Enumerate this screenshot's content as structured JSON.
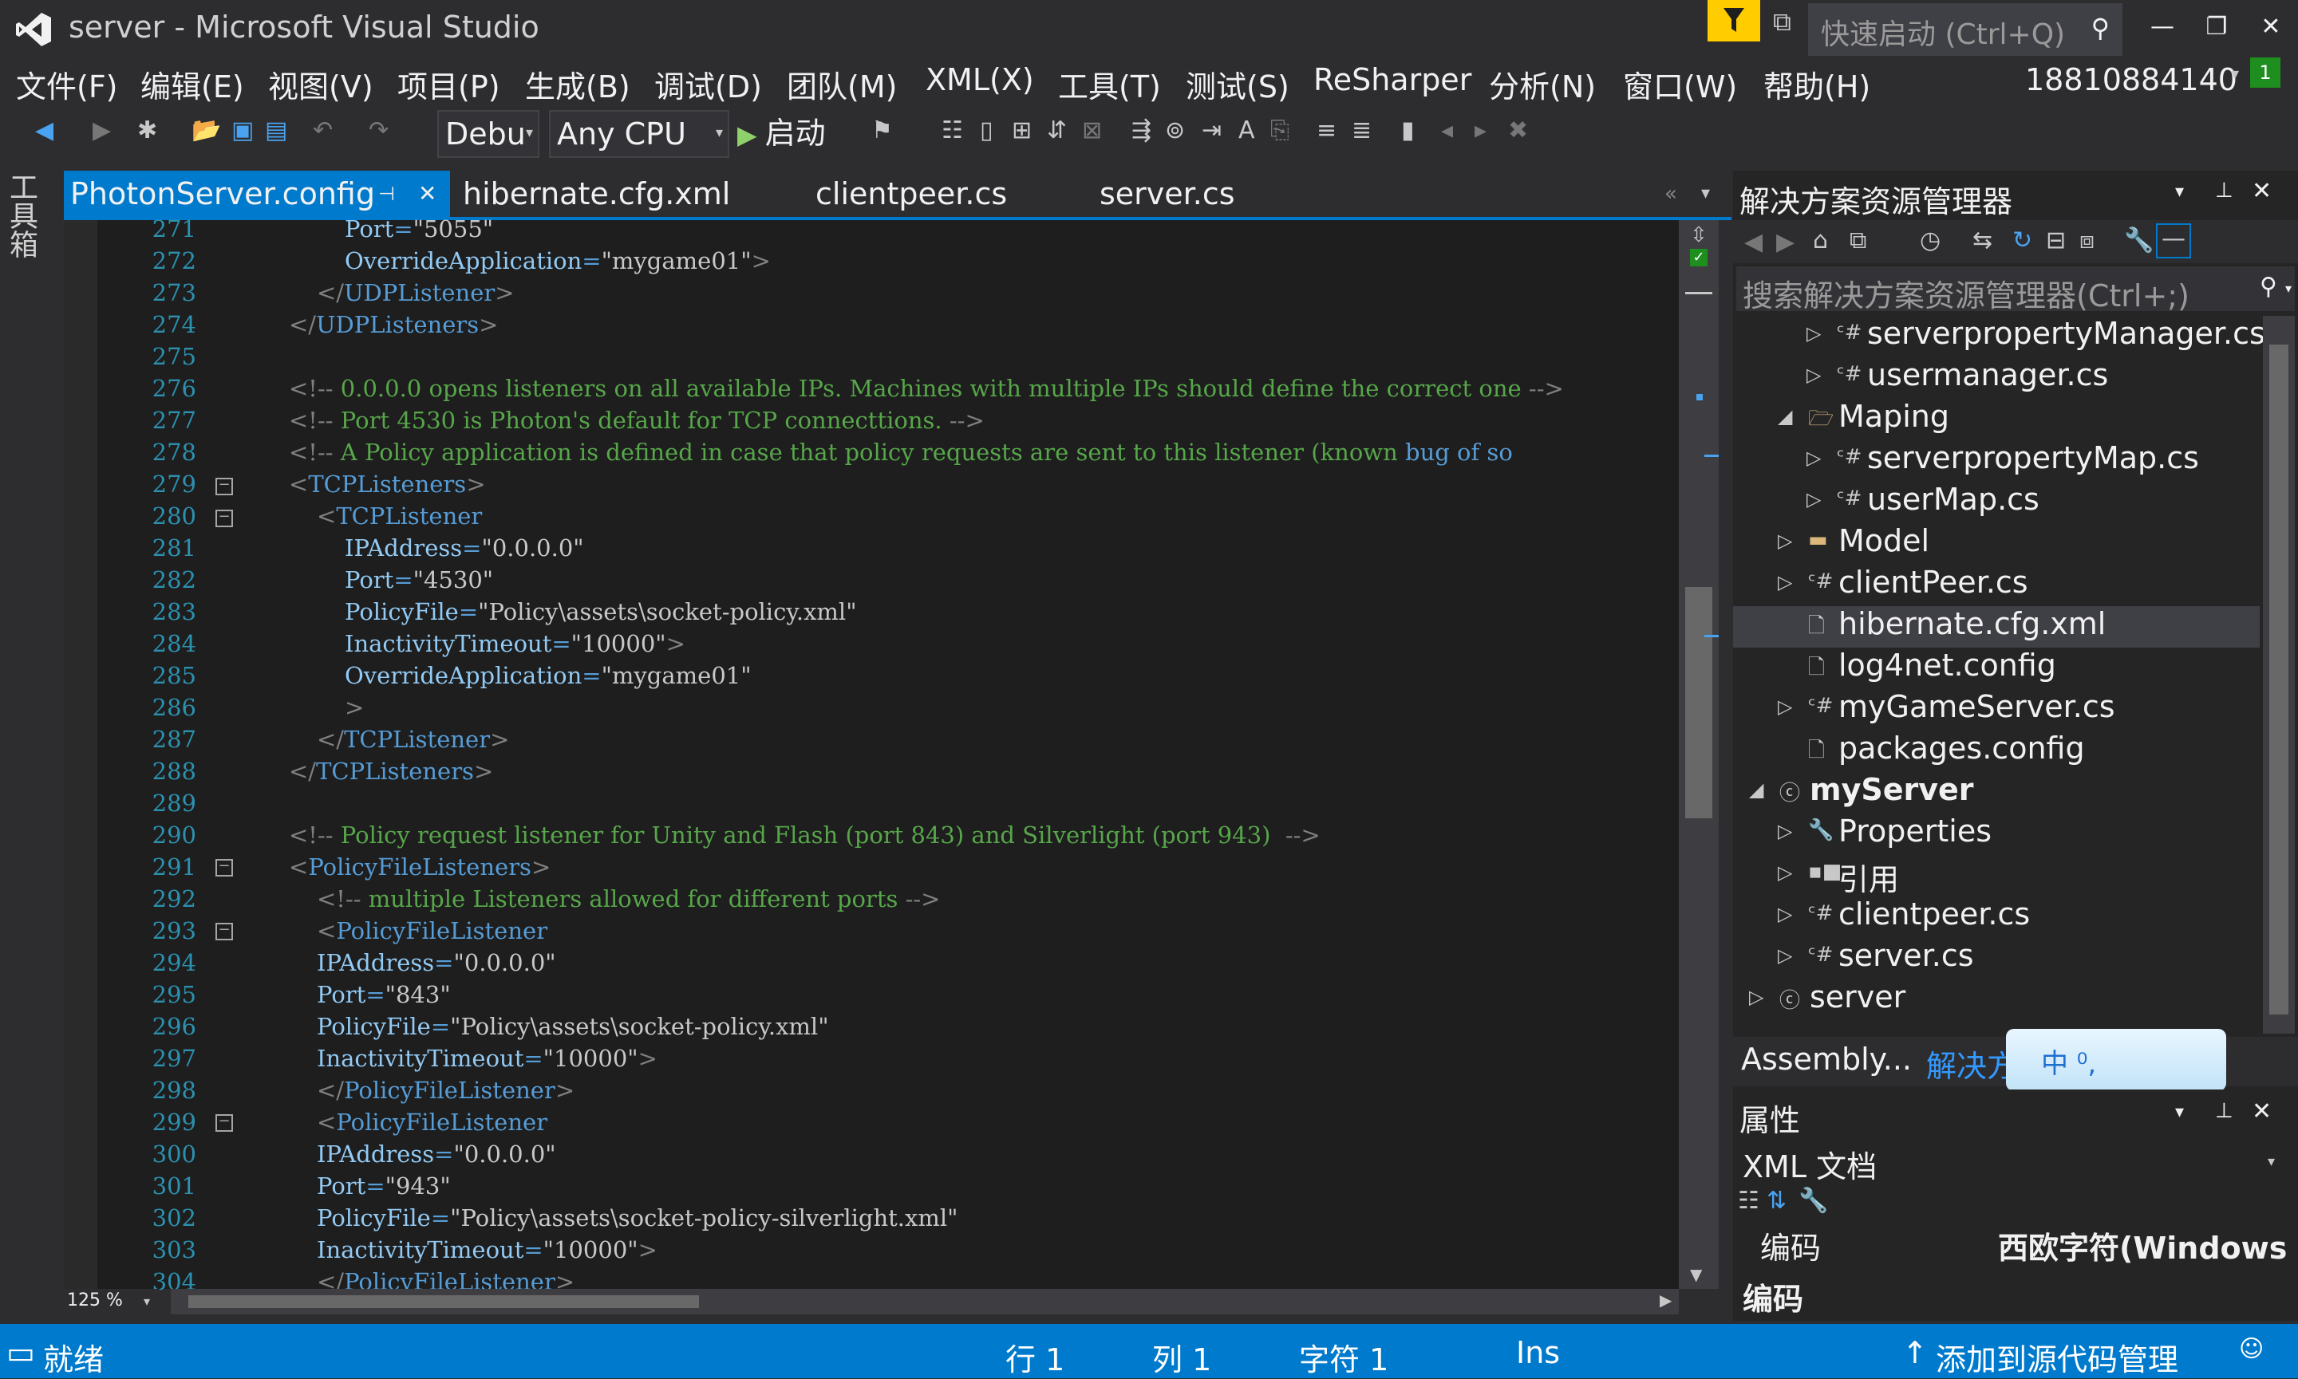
{
  "window": {
    "title": "server - Microsoft Visual Studio"
  },
  "quick_launch": {
    "placeholder": "快速启动 (Ctrl+Q)"
  },
  "menu": [
    "文件(F)",
    "编辑(E)",
    "视图(V)",
    "项目(P)",
    "生成(B)",
    "调试(D)",
    "团队(M)",
    "XML(X)",
    "工具(T)",
    "测试(S)",
    "ReSharper",
    "分析(N)",
    "窗口(W)",
    "帮助(H)"
  ],
  "account": {
    "name": "18810884140",
    "badge": "1"
  },
  "toolbar": {
    "configuration": "Debu",
    "platform": "Any CPU",
    "start_label": "启动"
  },
  "toolbox": {
    "label": "工具箱"
  },
  "editor_tabs": [
    "PhotonServer.config",
    "hibernate.cfg.xml",
    "clientpeer.cs",
    "server.cs"
  ],
  "editor": {
    "zoom": "125 %",
    "line_numbers": [
      "271",
      "272",
      "273",
      "274",
      "275",
      "276",
      "277",
      "278",
      "279",
      "280",
      "281",
      "282",
      "283",
      "284",
      "285",
      "286",
      "287",
      "288",
      "289",
      "290",
      "291",
      "292",
      "293",
      "294",
      "295",
      "296",
      "297",
      "298",
      "299",
      "300",
      "301",
      "302",
      "303",
      "304"
    ],
    "lines": {
      "l271": {
        "attr": "Port",
        "value": "5055"
      },
      "l272": {
        "attr": "OverrideApplication",
        "value": "mygame01"
      },
      "l273": {
        "close": "UDPListener"
      },
      "l274": {
        "close": "UDPListeners"
      },
      "l276": {
        "comment": "0.0.0.0 opens listeners on all available IPs. Machines with multiple IPs should define the correct one"
      },
      "l277": {
        "comment": "Port 4530 is Photon's default for TCP connecttions."
      },
      "l278": {
        "comment": "A Policy application is defined in case that policy requests are sent to this listener (known",
        "link": "bug of so"
      },
      "l279": {
        "open": "TCPListeners"
      },
      "l280": {
        "open": "TCPListener"
      },
      "l281": {
        "attr": "IPAddress",
        "value": "0.0.0.0"
      },
      "l282": {
        "attr": "Port",
        "value": "4530"
      },
      "l283": {
        "attr": "PolicyFile",
        "value": "Policy\\assets\\socket-policy.xml"
      },
      "l284": {
        "attr": "InactivityTimeout",
        "value": "10000"
      },
      "l285": {
        "attr": "OverrideApplication",
        "value": "mygame01"
      },
      "l286": {
        "bracket": ">"
      },
      "l287": {
        "close": "TCPListener"
      },
      "l288": {
        "close": "TCPListeners"
      },
      "l290": {
        "comment": "Policy request listener for Unity and Flash (port 843) and Silverlight (port 943) "
      },
      "l291": {
        "open": "PolicyFileListeners"
      },
      "l292": {
        "comment": "multiple Listeners allowed for different ports"
      },
      "l293": {
        "open": "PolicyFileListener"
      },
      "l294": {
        "attr": "IPAddress",
        "value": "0.0.0.0"
      },
      "l295": {
        "attr": "Port",
        "value": "843"
      },
      "l296": {
        "attr": "PolicyFile",
        "value": "Policy\\assets\\socket-policy.xml"
      },
      "l297": {
        "attr": "InactivityTimeout",
        "value": "10000"
      },
      "l298": {
        "close": "PolicyFileListener"
      },
      "l299": {
        "open": "PolicyFileListener"
      },
      "l300": {
        "attr": "IPAddress",
        "value": "0.0.0.0"
      },
      "l301": {
        "attr": "Port",
        "value": "943"
      },
      "l302": {
        "attr": "PolicyFile",
        "value": "Policy\\assets\\socket-policy-silverlight.xml"
      },
      "l303": {
        "attr": "InactivityTimeout",
        "value": "10000"
      },
      "l304": {
        "close": "PolicyFileListener"
      }
    }
  },
  "solution_explorer": {
    "title": "解决方案资源管理器",
    "search_placeholder": "搜索解决方案资源管理器(Ctrl+;)",
    "items": [
      {
        "label": "serverpropertyManager.cs",
        "icon": "csharp-file-icon"
      },
      {
        "label": "usermanager.cs",
        "icon": "csharp-file-icon"
      },
      {
        "label": "Maping",
        "icon": "folder-open-icon"
      },
      {
        "label": "serverpropertyMap.cs",
        "icon": "csharp-file-icon"
      },
      {
        "label": "userMap.cs",
        "icon": "csharp-file-icon"
      },
      {
        "label": "Model",
        "icon": "folder-icon"
      },
      {
        "label": "clientPeer.cs",
        "icon": "csharp-file-icon"
      },
      {
        "label": "hibernate.cfg.xml",
        "icon": "xml-file-icon",
        "selected": true
      },
      {
        "label": "log4net.config",
        "icon": "config-file-icon"
      },
      {
        "label": "myGameServer.cs",
        "icon": "csharp-file-icon"
      },
      {
        "label": "packages.config",
        "icon": "config-file-icon"
      },
      {
        "label": "myServer",
        "icon": "csharp-project-icon"
      },
      {
        "label": "Properties",
        "icon": "wrench-icon"
      },
      {
        "label": "引用",
        "icon": "references-icon"
      },
      {
        "label": "clientpeer.cs",
        "icon": "csharp-file-icon"
      },
      {
        "label": "server.cs",
        "icon": "csharp-file-icon"
      },
      {
        "label": "server",
        "icon": "csharp-project-icon"
      }
    ],
    "bottom_tabs": [
      "Assembly...",
      "解决方"
    ],
    "ime_text": "中 ⁰,"
  },
  "properties": {
    "title": "属性",
    "object": "XML 文档",
    "row_label": "编码",
    "row_value": "西欧字符(Windows",
    "description_title": "编码"
  },
  "status": {
    "ready": "就绪",
    "line": "行 1",
    "col": "列 1",
    "char": "字符 1",
    "ins": "Ins",
    "source_control": "添加到源代码管理"
  },
  "colors": {
    "accent": "#007acc",
    "background": "#2d2d30",
    "editor_bg": "#1e1e1e",
    "comment": "#57a64a",
    "tag": "#569cd6",
    "attribute": "#92caf4",
    "line_number": "#2b91af",
    "notification": "#ffcc00"
  }
}
